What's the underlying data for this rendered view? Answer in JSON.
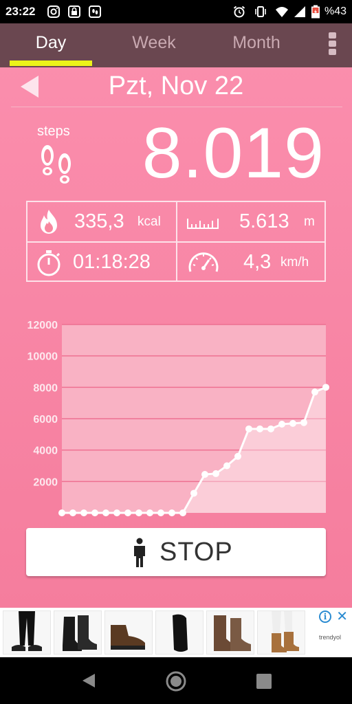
{
  "status_bar": {
    "time": "23:22",
    "battery": "%43",
    "icons": [
      "instagram-icon",
      "lock-icon",
      "pedometer-icon",
      "alarm-icon",
      "vibrate-icon",
      "wifi-icon",
      "signal-icon",
      "battery-icon"
    ]
  },
  "tabs": [
    {
      "label": "Day",
      "active": true
    },
    {
      "label": "Week",
      "active": false
    },
    {
      "label": "Month",
      "active": false
    }
  ],
  "date": "Pzt, Nov 22",
  "steps": {
    "label": "steps",
    "value": "8.019"
  },
  "stats": {
    "calories": {
      "value": "335,3",
      "unit": "kcal"
    },
    "distance": {
      "value": "5.613",
      "unit": "m"
    },
    "duration": {
      "value": "01:18:28"
    },
    "speed": {
      "value": "4,3",
      "unit": "km/h"
    }
  },
  "chart_data": {
    "type": "area",
    "x": [
      0,
      1,
      2,
      3,
      4,
      5,
      6,
      7,
      8,
      9,
      10,
      11,
      12,
      13,
      14,
      15,
      16,
      17,
      18,
      19,
      20,
      21,
      22,
      23,
      24
    ],
    "values": [
      0,
      0,
      0,
      0,
      0,
      0,
      0,
      0,
      0,
      0,
      0,
      0,
      1250,
      2450,
      2500,
      3000,
      3600,
      5350,
      5350,
      5350,
      5650,
      5700,
      5750,
      7700,
      8000
    ],
    "xticks": [
      2,
      4,
      6,
      8,
      10,
      12,
      14,
      16,
      18,
      20,
      22,
      24
    ],
    "yticks": [
      2000,
      4000,
      6000,
      8000,
      10000,
      12000
    ],
    "ylim": [
      0,
      12000
    ],
    "xlim": [
      0,
      24
    ],
    "grid": true,
    "colors": {
      "line": "#ffffff",
      "plot_bg": "#f9b2c4",
      "grid": "#ee6f91",
      "tick": "#fde8ee"
    }
  },
  "stop_button": {
    "label": "STOP"
  },
  "ad": {
    "brand": "trendyol",
    "info_symbol": "i",
    "close_symbol": "✕",
    "items": [
      "black-trousers-image",
      "black-boots-image",
      "brown-hiking-boots-image",
      "black-loafer-image",
      "brown-combat-boots-image",
      "tan-boots-image"
    ]
  },
  "colors": {
    "app_bg": "#f8879f",
    "tab_bar": "#6a4750",
    "tab_indicator": "#ecf319"
  }
}
